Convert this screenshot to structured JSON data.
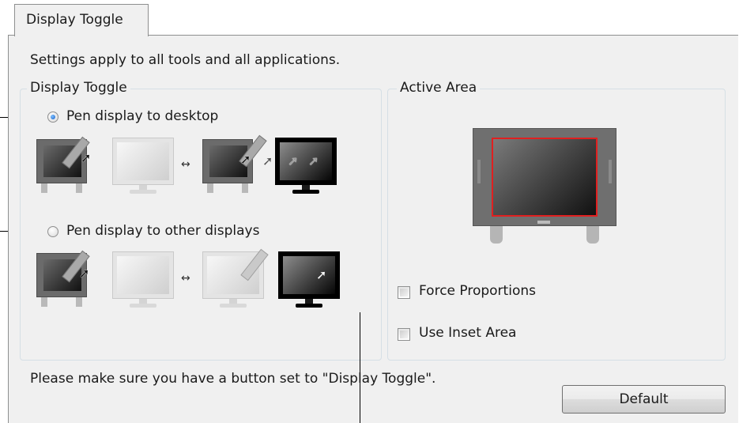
{
  "tab": {
    "label": "Display Toggle"
  },
  "info_text": "Settings apply to all tools and all applications.",
  "display_toggle": {
    "group_label": "Display Toggle",
    "options": [
      {
        "label": "Pen display to desktop",
        "selected": true
      },
      {
        "label": "Pen display to other displays",
        "selected": false
      }
    ]
  },
  "active_area": {
    "group_label": "Active Area",
    "force_proportions": {
      "label": "Force Proportions",
      "checked": false
    },
    "use_inset_area": {
      "label": "Use Inset Area",
      "checked": false
    }
  },
  "footer_note": "Please make sure you have a button set to \"Display Toggle\".",
  "default_button": "Default",
  "colors": {
    "active_area_border": "#e02020",
    "selected_radio": "#1a62c8"
  }
}
